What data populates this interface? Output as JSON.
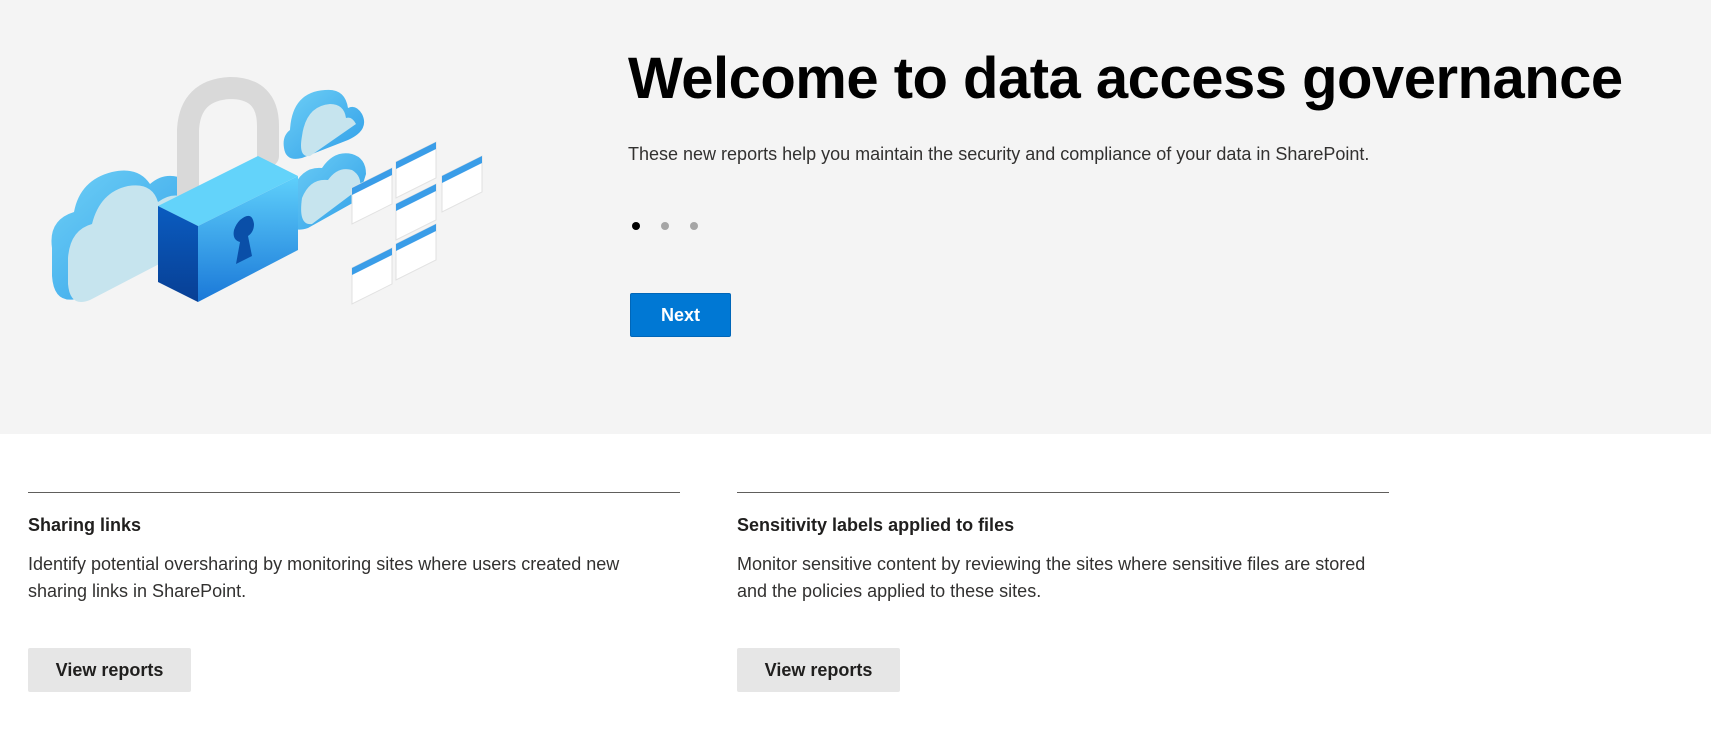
{
  "hero": {
    "title": "Welcome to data access governance",
    "subtitle": "These new reports help you maintain the security and compliance of your data in SharePoint.",
    "carousel": {
      "total": 3,
      "active": 1
    },
    "next_label": "Next",
    "illustration_icon": "lock-cloud-illustration-icon"
  },
  "cards": [
    {
      "title": "Sharing links",
      "description": "Identify potential oversharing by monitoring sites where users created new sharing links in SharePoint.",
      "button_label": "View reports"
    },
    {
      "title": "Sensitivity labels applied to files",
      "description": "Monitor sensitive content by reviewing the sites where sensitive files are stored and the policies applied to these sites.",
      "button_label": "View reports"
    }
  ],
  "colors": {
    "hero_background": "#f4f4f4",
    "primary": "#0078d4",
    "secondary_button": "#e6e6e6"
  }
}
